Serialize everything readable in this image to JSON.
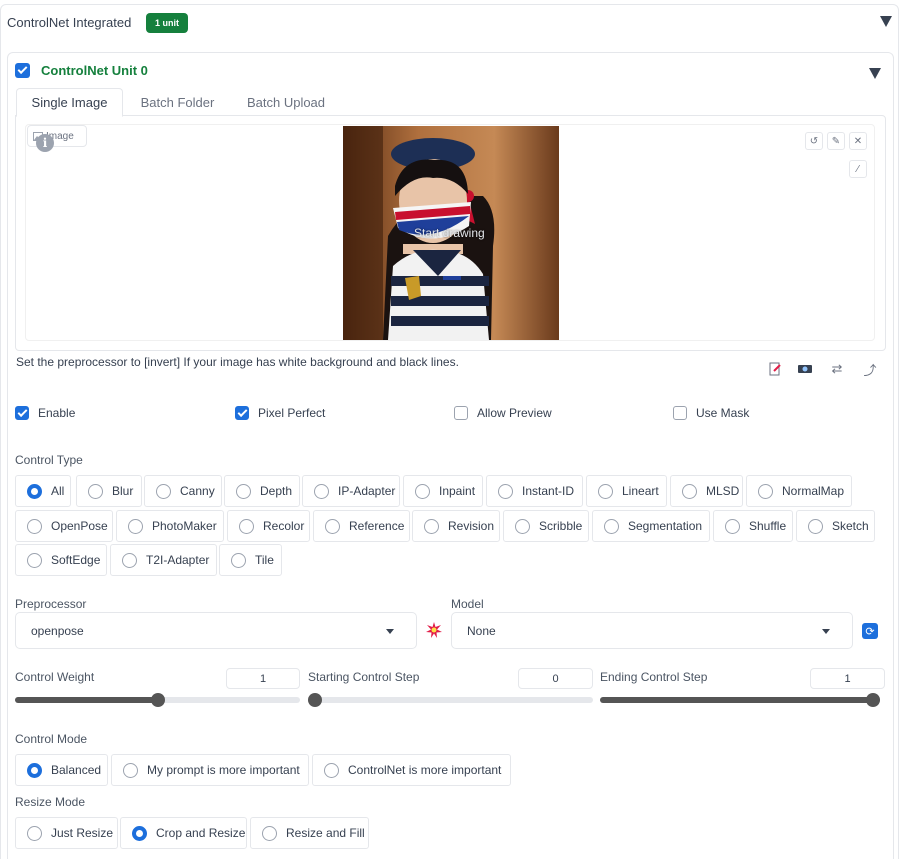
{
  "header": {
    "title": "ControlNet Integrated",
    "badge": "1 unit"
  },
  "unit": {
    "title": "ControlNet Unit 0",
    "enabled": true
  },
  "tabs": [
    {
      "label": "Single Image",
      "active": true
    },
    {
      "label": "Batch Folder",
      "active": false
    },
    {
      "label": "Batch Upload",
      "active": false
    }
  ],
  "image_panel": {
    "label": "Image",
    "overlay_text": "Start drawing"
  },
  "hint": "Set the preprocessor to [invert] If your image has white background and black lines.",
  "options": [
    {
      "label": "Enable",
      "checked": true
    },
    {
      "label": "Pixel Perfect",
      "checked": true
    },
    {
      "label": "Allow Preview",
      "checked": false
    },
    {
      "label": "Use Mask",
      "checked": false
    }
  ],
  "control_type": {
    "label": "Control Type",
    "selected": "All",
    "options": [
      "All",
      "Blur",
      "Canny",
      "Depth",
      "IP-Adapter",
      "Inpaint",
      "Instant-ID",
      "Lineart",
      "MLSD",
      "NormalMap",
      "OpenPose",
      "PhotoMaker",
      "Recolor",
      "Reference",
      "Revision",
      "Scribble",
      "Segmentation",
      "Shuffle",
      "Sketch",
      "SoftEdge",
      "T2I-Adapter",
      "Tile"
    ]
  },
  "preprocessor": {
    "label": "Preprocessor",
    "value": "openpose"
  },
  "model": {
    "label": "Model",
    "value": "None"
  },
  "sliders": [
    {
      "label": "Control Weight",
      "value": "1",
      "fraction": 0.5
    },
    {
      "label": "Starting Control Step",
      "value": "0",
      "fraction": 0.0
    },
    {
      "label": "Ending Control Step",
      "value": "1",
      "fraction": 1.0
    }
  ],
  "control_mode": {
    "label": "Control Mode",
    "selected": "Balanced",
    "options": [
      "Balanced",
      "My prompt is more important",
      "ControlNet is more important"
    ]
  },
  "resize_mode": {
    "label": "Resize Mode",
    "selected": "Crop and Resize",
    "options": [
      "Just Resize",
      "Crop and Resize",
      "Resize and Fill"
    ]
  },
  "colors": {
    "accent": "#1d6fdc",
    "unit_title": "#15803d",
    "badge": "#15803d"
  }
}
